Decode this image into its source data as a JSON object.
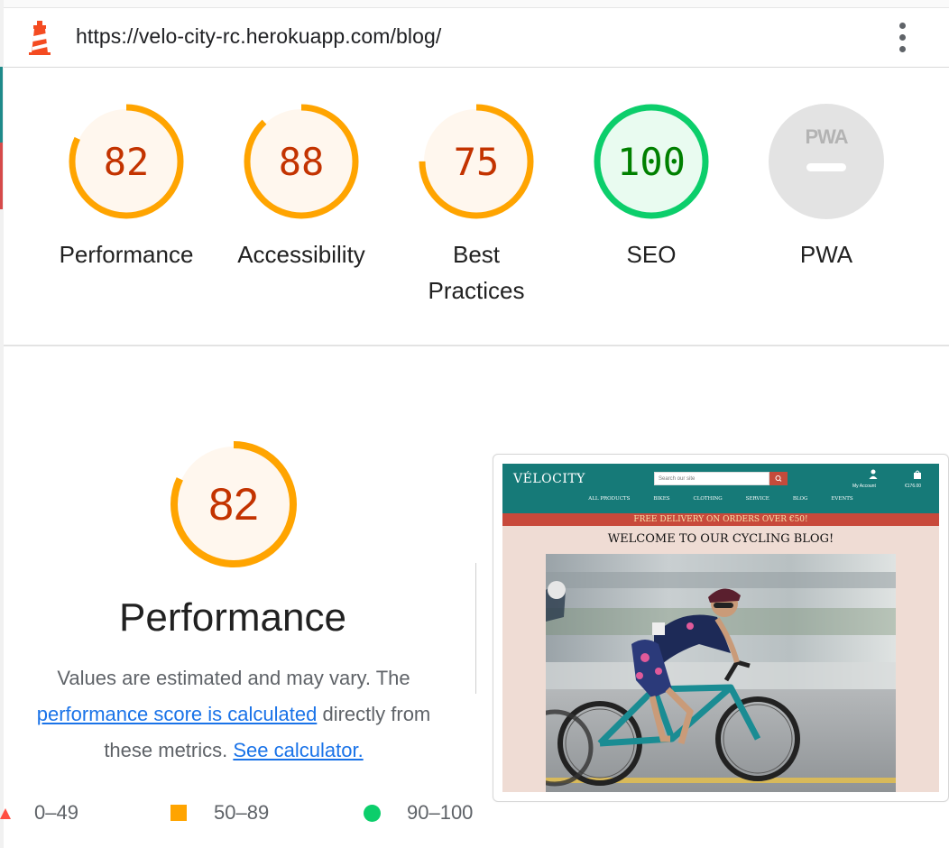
{
  "header": {
    "url": "https://velo-city-rc.herokuapp.com/blog/",
    "logo_icon": "lighthouse-icon",
    "menu_icon": "kebab-menu-icon"
  },
  "categories": [
    {
      "label": "Performance",
      "score": "82",
      "color": "#ffa400",
      "text_color": "#c33300",
      "bg": "#fff7ee",
      "fraction": 0.82
    },
    {
      "label": "Accessibility",
      "score": "88",
      "color": "#ffa400",
      "text_color": "#c33300",
      "bg": "#fff7ee",
      "fraction": 0.88
    },
    {
      "label_line1": "Best",
      "label_line2": "Practices",
      "score": "75",
      "color": "#ffa400",
      "text_color": "#c33300",
      "bg": "#fff7ee",
      "fraction": 0.75
    },
    {
      "label": "SEO",
      "score": "100",
      "color": "#0cce6b",
      "text_color": "#008000",
      "bg": "#e9fbf0",
      "fraction": 1.0
    },
    {
      "label": "PWA",
      "badge": "PWA",
      "color": "#e0e0e0",
      "text_color": "#b0b0b0"
    }
  ],
  "performance": {
    "score": "82",
    "fraction": 0.82,
    "title": "Performance",
    "desc_line1": "Values are estimated and may vary. The",
    "link1": "performance score is calculated",
    "desc_mid": "directly from",
    "desc_line3_pre": "these metrics.",
    "link2": "See calculator."
  },
  "legend": {
    "fail": "0–49",
    "average": "50–89",
    "pass": "90–100",
    "colors": {
      "fail": "#ff4e42",
      "average": "#ffa400",
      "pass": "#0cce6b"
    }
  },
  "thumbnail": {
    "logo": "VÉLOCITY",
    "search_placeholder": "Search our site",
    "account": "My Account",
    "bag_total": "€176.00",
    "nav": [
      "ALL PRODUCTS",
      "BIKES",
      "CLOTHING",
      "SERVICE",
      "BLOG",
      "EVENTS"
    ],
    "banner": "FREE DELIVERY ON ORDERS OVER €50!",
    "blog_title": "WELCOME TO OUR CYCLING BLOG!"
  }
}
